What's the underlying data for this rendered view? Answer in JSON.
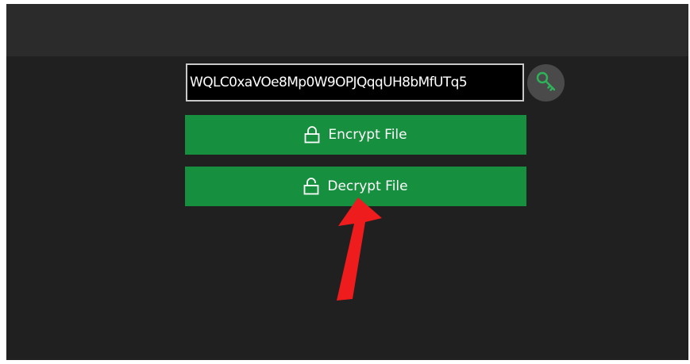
{
  "key_field": {
    "value": "WQLC0xaVOe8Mp0W9OPJQqqUH8bMfUTq5"
  },
  "icons": {
    "key": "key-icon",
    "encrypt": "lock-icon",
    "decrypt": "unlock-icon",
    "arrow": "red-arrow"
  },
  "buttons": {
    "encrypt_label": "Encrypt File",
    "decrypt_label": "Decrypt File"
  },
  "colors": {
    "button_green": "#168f3e",
    "key_icon_green": "#2fb35a",
    "arrow_red": "#ee1c1c"
  }
}
